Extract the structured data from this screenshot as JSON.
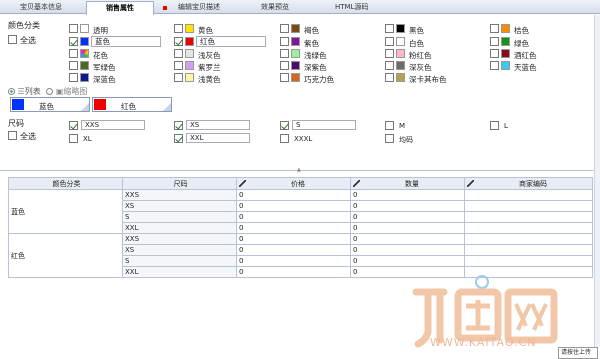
{
  "tabs": [
    {
      "label": "宝贝基本信息"
    },
    {
      "label": "销售属性"
    },
    {
      "label": "编辑宝贝描述"
    },
    {
      "label": "效果预览"
    },
    {
      "label": "HTML源码"
    }
  ],
  "color_section": {
    "title": "颜色分类",
    "select_all": "全选",
    "colors": [
      {
        "name": "透明",
        "hex": "#ffffff",
        "checked": false
      },
      {
        "name": "黄色",
        "hex": "#ffe400",
        "checked": false
      },
      {
        "name": "褐色",
        "hex": "#7a4a17",
        "checked": false
      },
      {
        "name": "黑色",
        "hex": "#000000",
        "checked": false
      },
      {
        "name": "桔色",
        "hex": "#ff8a00",
        "checked": false
      },
      {
        "name": "蓝色",
        "hex": "#0033ff",
        "checked": true
      },
      {
        "name": "红色",
        "hex": "#ee0000",
        "checked": true
      },
      {
        "name": "紫色",
        "hex": "#7a1a9a",
        "checked": false
      },
      {
        "name": "白色",
        "hex": "#ffffff",
        "checked": false
      },
      {
        "name": "绿色",
        "hex": "#1a8f1a",
        "checked": false
      },
      {
        "name": "花色",
        "hex": "#d84fb0",
        "checked": false
      },
      {
        "name": "浅灰色",
        "hex": "#e4e4e4",
        "checked": false
      },
      {
        "name": "浅绿色",
        "hex": "#9cf09c",
        "checked": false
      },
      {
        "name": "粉红色",
        "hex": "#ffb6c9",
        "checked": false
      },
      {
        "name": "酒红色",
        "hex": "#8a0a1e",
        "checked": false
      },
      {
        "name": "军绿色",
        "hex": "#4b6b23",
        "checked": false
      },
      {
        "name": "紫罗兰",
        "hex": "#d59ef0",
        "checked": false
      },
      {
        "name": "深紫色",
        "hex": "#4a0e6a",
        "checked": false
      },
      {
        "name": "深灰色",
        "hex": "#6b6b6b",
        "checked": false
      },
      {
        "name": "天蓝色",
        "hex": "#38c8f0",
        "checked": false
      },
      {
        "name": "深蓝色",
        "hex": "#0a1a8a",
        "checked": false
      },
      {
        "name": "浅黄色",
        "hex": "#fff6a8",
        "checked": false
      },
      {
        "name": "巧克力色",
        "hex": "#d2691e",
        "checked": false
      },
      {
        "name": "深卡其布色",
        "hex": "#b5a24a",
        "checked": false
      }
    ],
    "custom_names": {
      "blue": "蓝色",
      "red": "红色"
    },
    "view_list": "列表",
    "view_thumb": "缩略图",
    "selected": [
      {
        "name": "蓝色",
        "hex": "#0033ff"
      },
      {
        "name": "红色",
        "hex": "#ee0000"
      }
    ]
  },
  "size_section": {
    "title": "尺码",
    "select_all": "全选",
    "sizes": [
      {
        "name": "XXS",
        "checked": true,
        "value": "XXS"
      },
      {
        "name": "XS",
        "checked": true,
        "value": "XS"
      },
      {
        "name": "S",
        "checked": true,
        "value": "S"
      },
      {
        "name": "M",
        "checked": false,
        "value": ""
      },
      {
        "name": "L",
        "checked": false,
        "value": ""
      },
      {
        "name": "XL",
        "checked": false,
        "value": ""
      },
      {
        "name": "XXL",
        "checked": true,
        "value": "XXL"
      },
      {
        "name": "XXXL",
        "checked": false,
        "value": ""
      },
      {
        "name": "均码",
        "checked": false,
        "value": ""
      }
    ]
  },
  "table": {
    "headers": [
      "颜色分类",
      "尺码",
      "价格",
      "数量",
      "商家编码"
    ],
    "groups": [
      {
        "color": "蓝色",
        "rows": [
          {
            "size": "XXS",
            "price": "0",
            "qty": "0",
            "code": ""
          },
          {
            "size": "XS",
            "price": "0",
            "qty": "0",
            "code": ""
          },
          {
            "size": "S",
            "price": "0",
            "qty": "0",
            "code": ""
          },
          {
            "size": "XXL",
            "price": "0",
            "qty": "0",
            "code": ""
          }
        ]
      },
      {
        "color": "红色",
        "rows": [
          {
            "size": "XXS",
            "price": "0",
            "qty": "0",
            "code": ""
          },
          {
            "size": "XS",
            "price": "0",
            "qty": "0",
            "code": ""
          },
          {
            "size": "S",
            "price": "0",
            "qty": "0",
            "code": ""
          },
          {
            "size": "XXL",
            "price": "0",
            "qty": "0",
            "code": ""
          }
        ]
      }
    ]
  },
  "watermark": {
    "logo": "开淘网",
    "url": "WWW.KAITAO.CN"
  },
  "tooltip": "请按住上传",
  "accent": "#2a7a2a",
  "watermark_color": "#f2c7a8"
}
